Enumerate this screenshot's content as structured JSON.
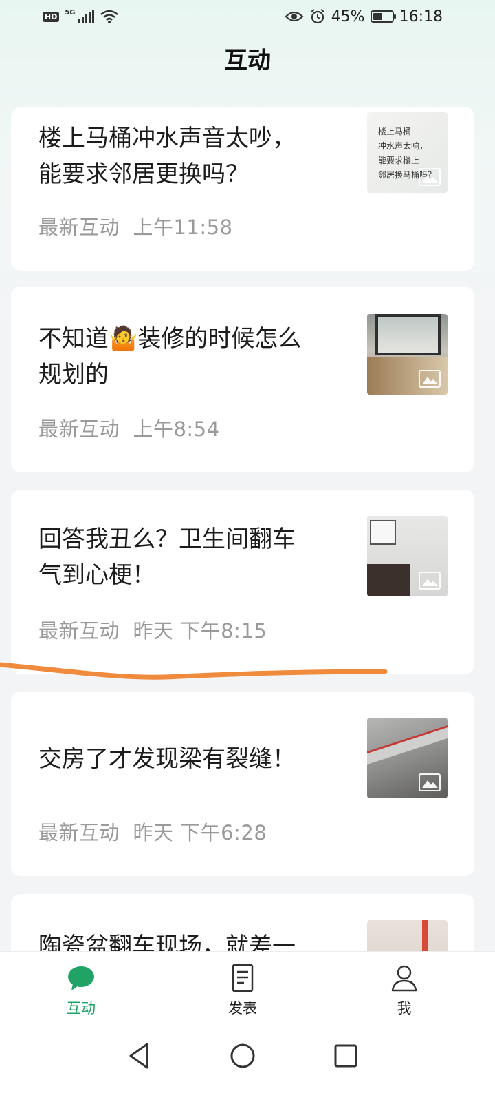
{
  "status_bar": {
    "network": "5G",
    "battery": "45%",
    "time": "16:18"
  },
  "header": {
    "title": "互动"
  },
  "posts": [
    {
      "title_line1": "楼上马桶冲水声音太吵，",
      "title_line2": "能要求邻居更换吗？",
      "label": "最新互动",
      "time": "上午11:58",
      "thumb_text": "楼上马桶\n冲水声太响，\n能要求楼上\n邻居换马桶吗？"
    },
    {
      "title_line1": "不知道🤷装修的时候怎么",
      "title_line2": "规划的",
      "label": "最新互动",
      "time": "上午8:54"
    },
    {
      "title_line1": "回答我丑么？卫生间翻车",
      "title_line2": "气到心梗！",
      "label": "最新互动",
      "time": "昨天 下午8:15"
    },
    {
      "title_line1": "交房了才发现梁有裂缝！",
      "label": "最新互动",
      "time": "昨天 下午6:28"
    },
    {
      "title_line1": "陶瓷盆翻车现场，就差一"
    }
  ],
  "bottom_nav": [
    {
      "label": "互动",
      "icon": "chat-bubble-icon",
      "active": true
    },
    {
      "label": "发表",
      "icon": "document-icon",
      "active": false
    },
    {
      "label": "我",
      "icon": "person-icon",
      "active": false
    }
  ],
  "colors": {
    "accent": "#21a366",
    "annotation": "#f08a3c"
  }
}
